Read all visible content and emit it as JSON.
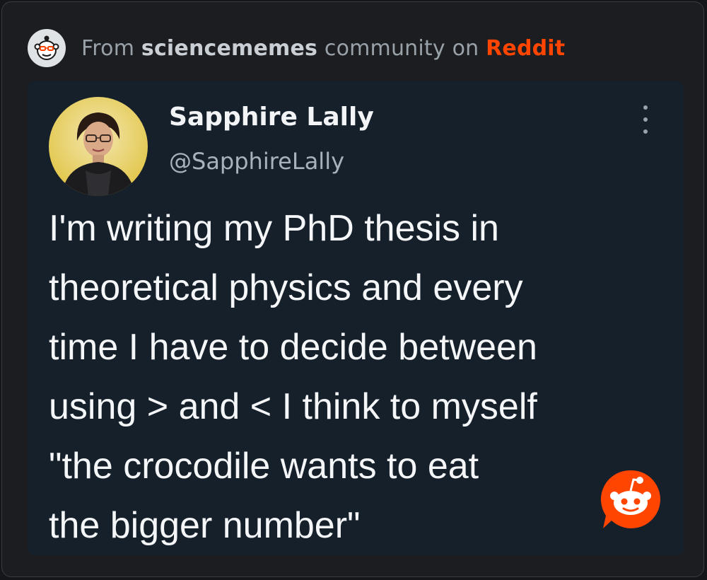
{
  "header": {
    "prefix": "From",
    "community": "sciencememes",
    "middle": "community on",
    "platform": "Reddit",
    "icon": "reddit-snoo-icon"
  },
  "tweet": {
    "author_name": "Sapphire Lally",
    "author_handle": "@SapphireLally",
    "body_lines": [
      "I'm writing my PhD thesis in",
      "theoretical physics and every",
      "time I have to decide between",
      "using > and < I think to myself",
      "\"the crocodile wants to eat",
      "the bigger number\""
    ],
    "more_icon": "more-vertical-icon"
  },
  "badge": {
    "icon": "reddit-logo-icon"
  },
  "colors": {
    "background": "#141619",
    "card": "#1b1d20",
    "tweet_bg": "#15202b",
    "reddit_orange": "#ff4500",
    "text": "#f4f6f8",
    "muted": "#a9b2bb"
  }
}
